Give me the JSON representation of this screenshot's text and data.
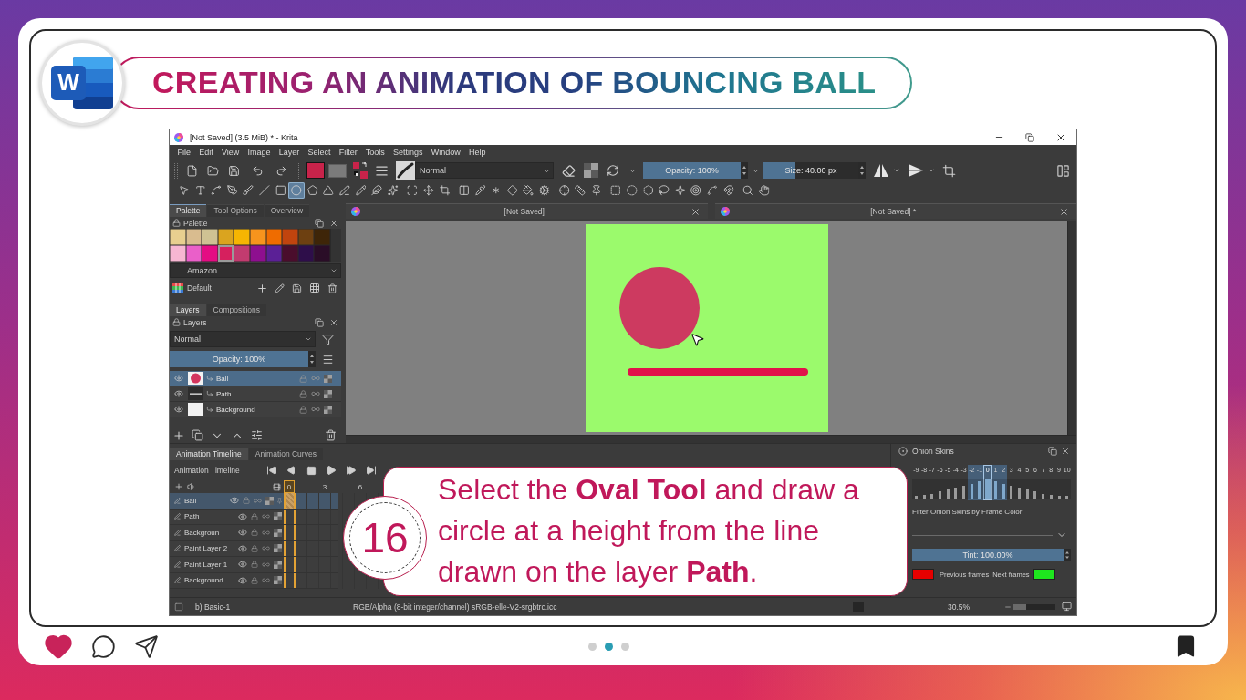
{
  "slide": {
    "title": "CREATING AN ANIMATION OF BOUNCING BALL",
    "logo_letter": "W"
  },
  "window": {
    "title": "[Not Saved] (3.5 MiB) * - Krita"
  },
  "menu": [
    "File",
    "Edit",
    "View",
    "Image",
    "Layer",
    "Select",
    "Filter",
    "Tools",
    "Settings",
    "Window",
    "Help"
  ],
  "toolbar": {
    "colors": [
      {
        "kind": "foreground",
        "color": "#c8234a"
      },
      {
        "kind": "background",
        "color": "#7b7b7b"
      }
    ],
    "blend_mode": "Normal",
    "opacity": {
      "label": "Opacity: 100%",
      "level": 1
    },
    "size": {
      "label": "Size: 40.00 px",
      "level": 0.34
    }
  },
  "tool_groups": [
    [
      {
        "kind": "pointer",
        "selected": false
      },
      {
        "kind": "text",
        "selected": false
      },
      {
        "kind": "edit-shapes",
        "selected": false
      },
      {
        "kind": "calligraphy",
        "selected": false
      },
      {
        "kind": "brush",
        "selected": false
      },
      {
        "kind": "line",
        "selected": false
      },
      {
        "kind": "rectangle",
        "selected": false
      },
      {
        "kind": "ellipse",
        "selected": true
      },
      {
        "kind": "polygon",
        "selected": false
      },
      {
        "kind": "polyline",
        "selected": false
      },
      {
        "kind": "bezier",
        "selected": false
      },
      {
        "kind": "freehand-path",
        "selected": false
      },
      {
        "kind": "dynamic-brush",
        "selected": false
      },
      {
        "kind": "multibrush",
        "selected": false
      }
    ],
    [
      {
        "kind": "transform",
        "selected": false
      },
      {
        "kind": "move",
        "selected": false
      },
      {
        "kind": "crop",
        "selected": false
      }
    ],
    [
      {
        "kind": "gradient",
        "selected": false
      },
      {
        "kind": "color-picker",
        "selected": false
      },
      {
        "kind": "smart-patch",
        "selected": false
      },
      {
        "kind": "similar-fill",
        "selected": false
      },
      {
        "kind": "fill",
        "selected": false
      },
      {
        "kind": "pattern",
        "selected": false
      }
    ],
    [
      {
        "kind": "assistant",
        "selected": false
      },
      {
        "kind": "measure",
        "selected": false
      },
      {
        "kind": "reference",
        "selected": false
      }
    ],
    [
      {
        "kind": "rect-select",
        "selected": false
      },
      {
        "kind": "ellipse-select",
        "selected": false
      },
      {
        "kind": "polygon-select",
        "selected": false
      },
      {
        "kind": "freehand-select",
        "selected": false
      },
      {
        "kind": "contiguous-select",
        "selected": false
      },
      {
        "kind": "similar-select",
        "selected": false
      },
      {
        "kind": "bezier-select",
        "selected": false
      },
      {
        "kind": "magnetic-select",
        "selected": false
      }
    ],
    [
      {
        "kind": "zoom",
        "selected": false
      },
      {
        "kind": "pan",
        "selected": false
      }
    ]
  ],
  "palette_docker": {
    "tabs": [
      {
        "label": "Palette",
        "selected": true
      },
      {
        "label": "Tool Options",
        "selected": false
      },
      {
        "label": "Overview",
        "selected": false
      }
    ],
    "title": "Palette",
    "swatches": [
      {
        "color": "#e8cf8f",
        "selected": false
      },
      {
        "color": "#d9bc8f",
        "selected": false
      },
      {
        "color": "#cfc293",
        "selected": false
      },
      {
        "color": "#daa41f",
        "selected": false
      },
      {
        "color": "#f6b502",
        "selected": false
      },
      {
        "color": "#f7941d",
        "selected": false
      },
      {
        "color": "#ef6c00",
        "selected": false
      },
      {
        "color": "#c1440e",
        "selected": false
      },
      {
        "color": "#6d4011",
        "selected": false
      },
      {
        "color": "#3e2508",
        "selected": false
      },
      {
        "color": "#f7b6d2",
        "selected": false
      },
      {
        "color": "#ea5fc9",
        "selected": false
      },
      {
        "color": "#e40d83",
        "selected": false
      },
      {
        "color": "#d6205e",
        "selected": true
      },
      {
        "color": "#c23b6f",
        "selected": false
      },
      {
        "color": "#8e0f8f",
        "selected": false
      },
      {
        "color": "#5b2096",
        "selected": false
      },
      {
        "color": "#4a0d2c",
        "selected": false
      },
      {
        "color": "#2e0e4a",
        "selected": false
      },
      {
        "color": "#2a0d27",
        "selected": false
      }
    ],
    "set": "Amazon",
    "name": "Default"
  },
  "layers_docker": {
    "tabs": [
      {
        "label": "Layers",
        "selected": true
      },
      {
        "label": "Compositions",
        "selected": false
      }
    ],
    "title": "Layers",
    "blend_mode": "Normal",
    "opacity": {
      "label": "Opacity: 100%",
      "level": 1
    },
    "layers": [
      {
        "name": "Ball",
        "kind": "circle",
        "selected": true
      },
      {
        "name": "Path",
        "kind": "line",
        "selected": false
      },
      {
        "name": "Background",
        "kind": "blank",
        "selected": false
      }
    ]
  },
  "views": [
    {
      "title": "[Not Saved]"
    },
    {
      "title": "[Not Saved] *"
    }
  ],
  "timeline": {
    "tabs": [
      {
        "label": "Animation Timeline",
        "selected": true
      },
      {
        "label": "Animation Curves",
        "selected": false
      }
    ],
    "title": "Animation Timeline",
    "frames": [
      {
        "label": "0",
        "selected": true
      },
      {
        "label": "3",
        "selected": false
      },
      {
        "label": "6",
        "selected": false
      }
    ],
    "layers": [
      {
        "name": "Ball",
        "selected": true
      },
      {
        "name": "Path",
        "selected": false
      },
      {
        "name": "Backgroun",
        "selected": false
      },
      {
        "name": "Paint Layer 2",
        "selected": false
      },
      {
        "name": "Paint Layer 1",
        "selected": false
      },
      {
        "name": "Background",
        "selected": false
      }
    ]
  },
  "onion_skins": {
    "title": "Onion Skins",
    "frames": [
      {
        "label": "-9",
        "on": false,
        "selected": false,
        "level": 0.15
      },
      {
        "label": "-8",
        "on": false,
        "selected": false,
        "level": 0.2
      },
      {
        "label": "-7",
        "on": false,
        "selected": false,
        "level": 0.25
      },
      {
        "label": "-6",
        "on": false,
        "selected": false,
        "level": 0.35
      },
      {
        "label": "-5",
        "on": false,
        "selected": false,
        "level": 0.45
      },
      {
        "label": "-4",
        "on": false,
        "selected": false,
        "level": 0.55
      },
      {
        "label": "-3",
        "on": false,
        "selected": false,
        "level": 0.65
      },
      {
        "label": "-2",
        "on": true,
        "selected": false,
        "level": 0.75
      },
      {
        "label": "-1",
        "on": true,
        "selected": false,
        "level": 0.85
      },
      {
        "label": "0",
        "on": true,
        "selected": true,
        "level": 1
      },
      {
        "label": "1",
        "on": true,
        "selected": false,
        "level": 0.85
      },
      {
        "label": "2",
        "on": true,
        "selected": false,
        "level": 0.75
      },
      {
        "label": "3",
        "on": false,
        "selected": false,
        "level": 0.65
      },
      {
        "label": "4",
        "on": false,
        "selected": false,
        "level": 0.55
      },
      {
        "label": "5",
        "on": false,
        "selected": false,
        "level": 0.45
      },
      {
        "label": "6",
        "on": false,
        "selected": false,
        "level": 0.35
      },
      {
        "label": "7",
        "on": false,
        "selected": false,
        "level": 0.25
      },
      {
        "label": "8",
        "on": false,
        "selected": false,
        "level": 0.2
      },
      {
        "label": "9",
        "on": false,
        "selected": false,
        "level": 0.15
      },
      {
        "label": "10",
        "on": false,
        "selected": false,
        "level": 0.15
      }
    ],
    "filter_label": "Filter Onion Skins by Frame Color",
    "tint": {
      "label": "Tint: 100.00%",
      "level": 1
    },
    "frame_colors": [
      {
        "label": "Previous frames",
        "color": "#e60000"
      },
      {
        "label": "Next frames",
        "color": "#1ee61e"
      }
    ]
  },
  "status_bar": {
    "brush": "b) Basic-1",
    "color_space": "RGB/Alpha (8-bit integer/channel) sRGB-elle-V2-srgbtrc.icc",
    "zoom": {
      "label": "30.5%",
      "level": 0.3
    }
  },
  "callout": {
    "number": "16",
    "text": "Select the **Oval Tool** and draw a circle at a height from the line drawn on the layer **Path**."
  },
  "pager": [
    {
      "selected": false
    },
    {
      "selected": true
    },
    {
      "selected": false
    }
  ],
  "actions": {
    "liked": true,
    "bookmarked": true
  }
}
